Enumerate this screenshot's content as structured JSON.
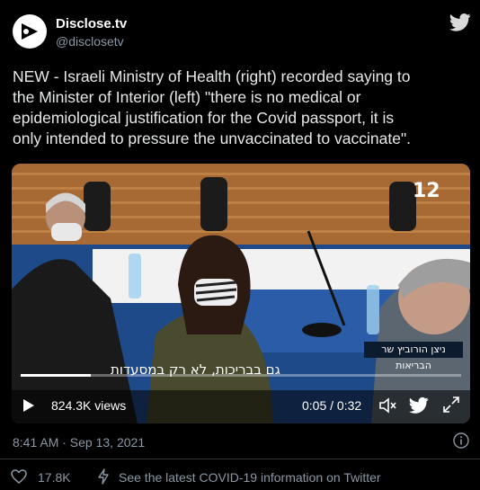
{
  "author": {
    "name": "Disclose.tv",
    "handle": "@disclosetv"
  },
  "tweet": {
    "text_lines": [
      "NEW - Israeli Ministry of Health (right) recorded saying to",
      "the Minister of Interior (left) \"there is no medical or",
      "epidemiological justification for the Covid passport, it is",
      "only intended to pressure the unvaccinated to vaccinate\"."
    ]
  },
  "video": {
    "channel_badge": "12",
    "chyron": "ניצן הורוביץ שר הבריאות",
    "subtitle": "גם בבריכות, לא רק במסעדות",
    "views": "824.3K views",
    "time": "0:05 / 0:32",
    "progress": 0.16
  },
  "meta": {
    "timestamp": "8:41 AM · Sep 13, 2021"
  },
  "footer": {
    "likes": "17.8K",
    "covid_link": "See the latest COVID-19 information on Twitter"
  },
  "colors": {
    "background": "#000000",
    "text": "#e7e9ea",
    "muted": "#8b98a5"
  }
}
